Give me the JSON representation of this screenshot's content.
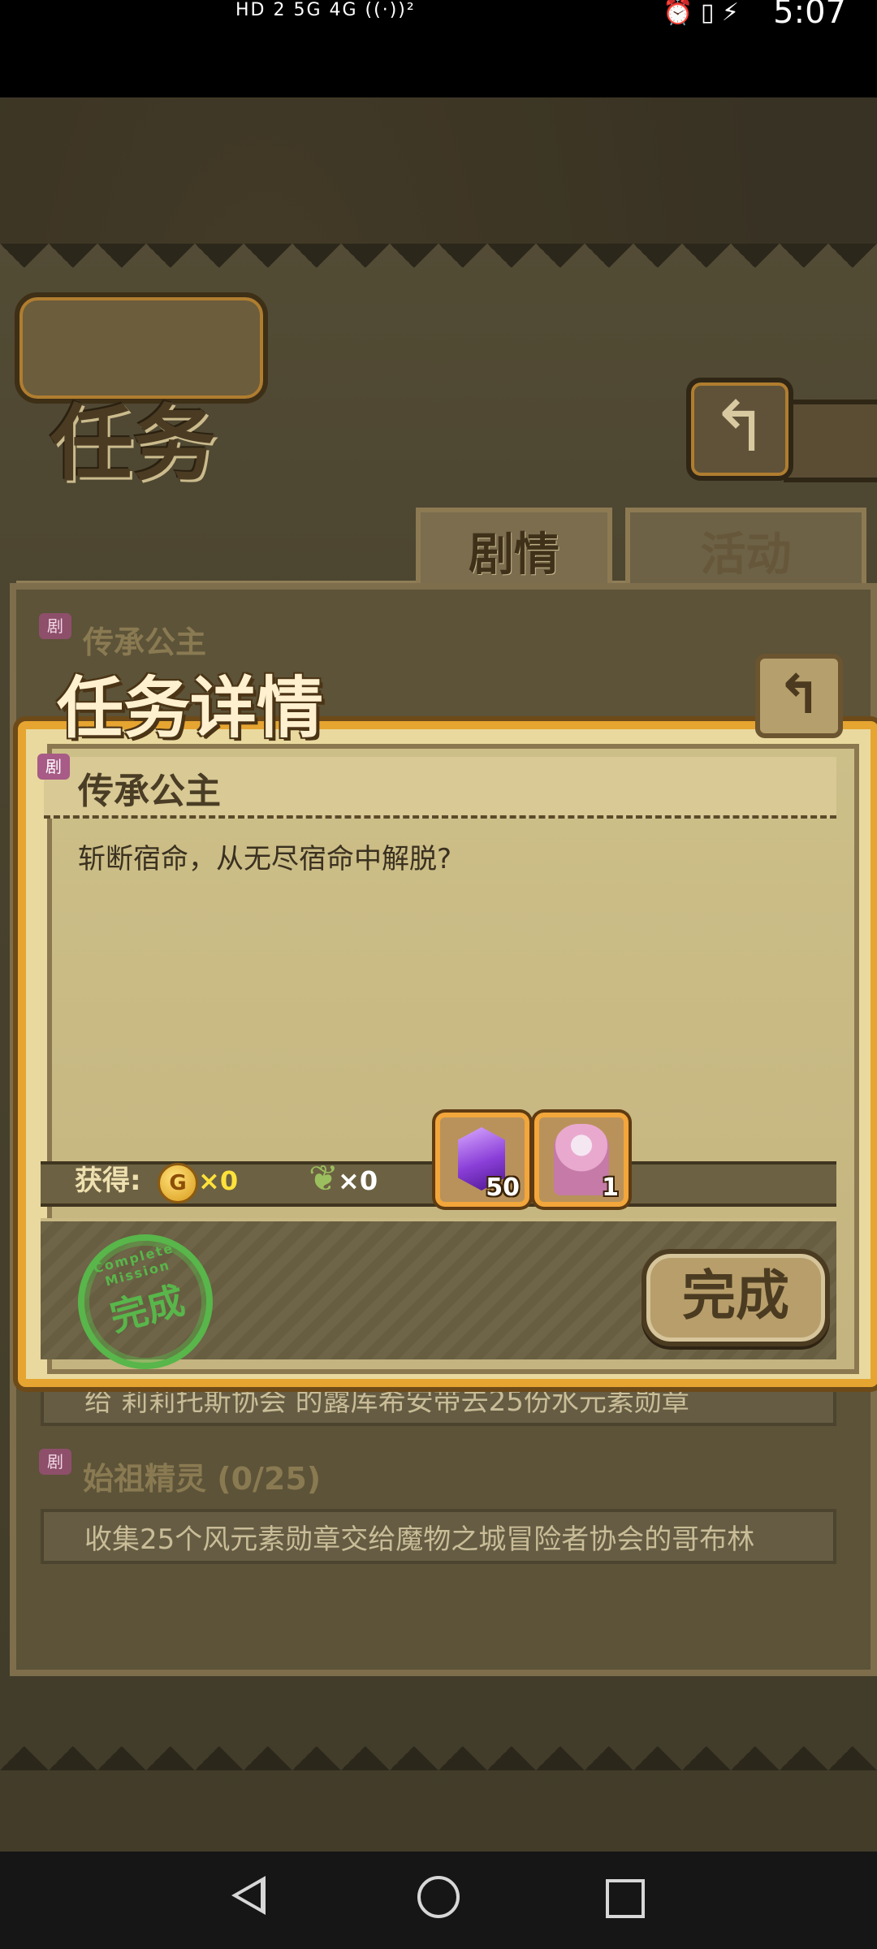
{
  "status_bar": {
    "left": "HD 2  5G  4G  ((·))²",
    "icons": "⏰ ▯ ⚡",
    "time": "5:07"
  },
  "header": {
    "title": "任务"
  },
  "tabs": [
    {
      "label": "剧情",
      "selected": true
    },
    {
      "label": "活动",
      "selected": false
    }
  ],
  "background_list": {
    "item1": {
      "badge": "剧",
      "title": "传承公主"
    },
    "item2": {
      "desc": "给 莉莉托斯协会 的露库希安带去25份水元素勋章"
    },
    "item3": {
      "badge": "剧",
      "title": "始祖精灵 (0/25)",
      "desc": "收集25个风元素勋章交给魔物之城冒险者协会的哥布林"
    }
  },
  "dialog": {
    "title": "任务详情",
    "back_icon": "↰",
    "quest_badge": "剧",
    "quest_title": "传承公主",
    "description": "斩断宿命，从无尽宿命中解脱?",
    "reward_label": "获得:",
    "coin_icon": "G",
    "coin_value": "×0",
    "feather_value": "×0",
    "items": [
      {
        "icon": "crystal-icon",
        "count": "50"
      },
      {
        "icon": "character-card-icon",
        "count": "1"
      }
    ],
    "stamp_main": "完成",
    "stamp_ring": "Complete Mission",
    "complete_button": "完成"
  },
  "colors": {
    "accent_orange": "#e6a531",
    "stamp_green": "#58b64a",
    "parchment": "#cdbf88"
  }
}
